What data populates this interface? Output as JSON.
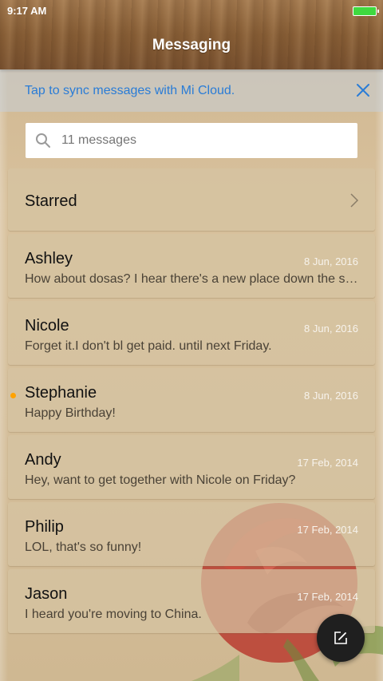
{
  "status_bar": {
    "time": "9:17 AM"
  },
  "header": {
    "title": "Messaging"
  },
  "sync_banner": {
    "text": "Tap to sync messages with Mi Cloud."
  },
  "search": {
    "placeholder": "11 messages"
  },
  "starred": {
    "label": "Starred"
  },
  "conversations": [
    {
      "name": "Ashley",
      "date": "8 Jun, 2016",
      "preview": "How about dosas? I hear there's a new place down the st…",
      "unread": false
    },
    {
      "name": "Nicole",
      "date": "8 Jun, 2016",
      "preview": "Forget it.I don't bl get paid. until next Friday.",
      "unread": false
    },
    {
      "name": "Stephanie",
      "date": "8 Jun, 2016",
      "preview": "Happy Birthday!",
      "unread": true
    },
    {
      "name": "Andy",
      "date": "17 Feb, 2014",
      "preview": "Hey, want to get together with Nicole on Friday?",
      "unread": false
    },
    {
      "name": "Philip",
      "date": "17 Feb, 2014",
      "preview": "LOL, that's so funny!",
      "unread": false
    },
    {
      "name": "Jason",
      "date": "17 Feb, 2014",
      "preview": "I heard you're moving to China.",
      "unread": false
    }
  ],
  "colors": {
    "accent": "#2a7cd6",
    "unread_dot": "#ffa200",
    "fab": "#1f1f1f"
  },
  "icons": {
    "close": "close-icon",
    "search": "search-icon",
    "chevron": "chevron-right-icon",
    "compose": "compose-icon"
  }
}
